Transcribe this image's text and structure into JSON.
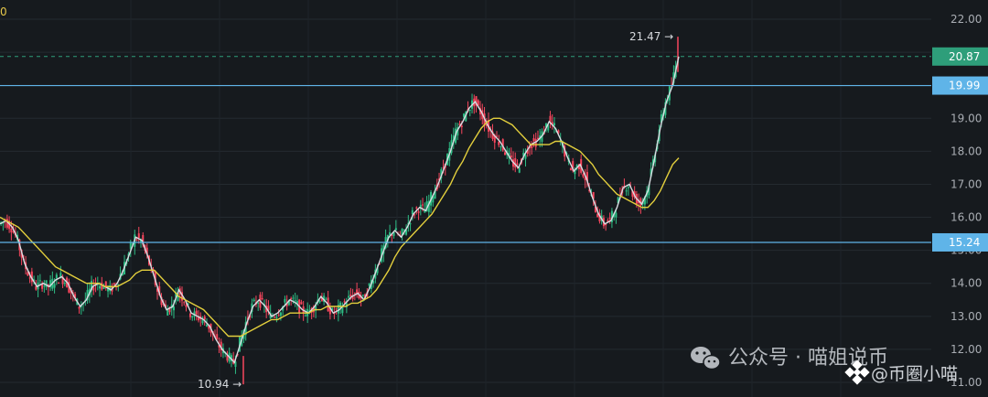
{
  "chart_data": {
    "type": "line",
    "title": "",
    "xlabel": "",
    "ylabel": "",
    "ylim": [
      10.8,
      22.2
    ],
    "grid": true,
    "y_ticks": [
      "11.00",
      "12.00",
      "13.00",
      "14.00",
      "15.00",
      "16.00",
      "17.00",
      "18.00",
      "19.00",
      "20.00",
      "21.00",
      "22.00"
    ],
    "y_tick_values": [
      11,
      12,
      13,
      14,
      15,
      16,
      17,
      18,
      19,
      20,
      21,
      22
    ],
    "horizontal_levels": [
      {
        "name": "level-upper",
        "value": 19.99,
        "label": "19.99",
        "color": "#5fb4e8"
      },
      {
        "name": "level-lower",
        "value": 15.24,
        "label": "15.24",
        "color": "#5fb4e8"
      }
    ],
    "current_price": {
      "value": 20.87,
      "label": "20.87",
      "color": "#2e9e7a"
    },
    "annotations": [
      {
        "name": "high-label",
        "text": "21.47 →",
        "value": 21.47
      },
      {
        "name": "low-label",
        "text": "10.94 →",
        "value": 10.94
      }
    ],
    "series": [
      {
        "kind": "close-fast-ma",
        "color": "#d9dde2",
        "values": [
          15.8,
          15.9,
          15.7,
          15.3,
          14.6,
          14.2,
          13.9,
          14.0,
          13.9,
          14.1,
          14.2,
          14.0,
          13.6,
          13.3,
          13.5,
          13.9,
          14.0,
          13.9,
          13.8,
          14.0,
          14.4,
          14.9,
          15.4,
          15.3,
          14.8,
          14.2,
          13.6,
          13.2,
          13.3,
          13.8,
          13.5,
          13.1,
          13.0,
          12.9,
          12.7,
          12.3,
          12.0,
          11.8,
          11.6,
          12.2,
          12.8,
          13.3,
          13.5,
          13.3,
          13.0,
          13.1,
          13.3,
          13.5,
          13.4,
          13.2,
          13.1,
          13.3,
          13.6,
          13.4,
          13.1,
          13.2,
          13.4,
          13.6,
          13.7,
          13.5,
          13.9,
          14.4,
          14.9,
          15.4,
          15.6,
          15.4,
          15.7,
          16.1,
          16.3,
          16.2,
          16.6,
          17.0,
          17.5,
          18.0,
          18.6,
          18.9,
          19.3,
          19.5,
          19.2,
          18.8,
          18.5,
          18.3,
          18.0,
          17.7,
          17.5,
          17.9,
          18.2,
          18.3,
          18.5,
          18.9,
          18.7,
          18.3,
          17.8,
          17.4,
          17.6,
          17.2,
          16.6,
          16.1,
          15.8,
          15.9,
          16.3,
          16.9,
          17.0,
          16.6,
          16.4,
          16.8,
          17.7,
          18.7,
          19.5,
          20.0,
          20.87
        ]
      },
      {
        "kind": "slow-ma",
        "color": "#e3cf3d",
        "values": [
          16.0,
          15.9,
          15.8,
          15.7,
          15.5,
          15.3,
          15.1,
          14.9,
          14.7,
          14.5,
          14.4,
          14.3,
          14.2,
          14.1,
          14.0,
          14.0,
          14.0,
          13.9,
          13.9,
          13.9,
          14.0,
          14.1,
          14.3,
          14.4,
          14.4,
          14.4,
          14.2,
          14.0,
          13.8,
          13.6,
          13.5,
          13.4,
          13.3,
          13.2,
          13.0,
          12.8,
          12.6,
          12.4,
          12.4,
          12.4,
          12.5,
          12.6,
          12.7,
          12.8,
          12.9,
          12.9,
          13.0,
          13.1,
          13.1,
          13.1,
          13.1,
          13.2,
          13.2,
          13.3,
          13.3,
          13.3,
          13.3,
          13.4,
          13.4,
          13.5,
          13.6,
          13.8,
          14.1,
          14.4,
          14.8,
          15.1,
          15.3,
          15.5,
          15.7,
          15.9,
          16.1,
          16.4,
          16.7,
          17.0,
          17.4,
          17.7,
          18.1,
          18.4,
          18.7,
          18.9,
          19.0,
          19.0,
          18.9,
          18.8,
          18.6,
          18.4,
          18.2,
          18.2,
          18.2,
          18.2,
          18.3,
          18.3,
          18.2,
          18.1,
          18.0,
          17.8,
          17.6,
          17.3,
          17.1,
          16.9,
          16.7,
          16.6,
          16.5,
          16.4,
          16.3,
          16.3,
          16.5,
          16.8,
          17.2,
          17.6,
          17.8
        ]
      }
    ]
  },
  "top_left_fragment": "0",
  "watermark": {
    "wechat": "公众号 · 喵姐说币",
    "binance": "@币圈小喵"
  }
}
